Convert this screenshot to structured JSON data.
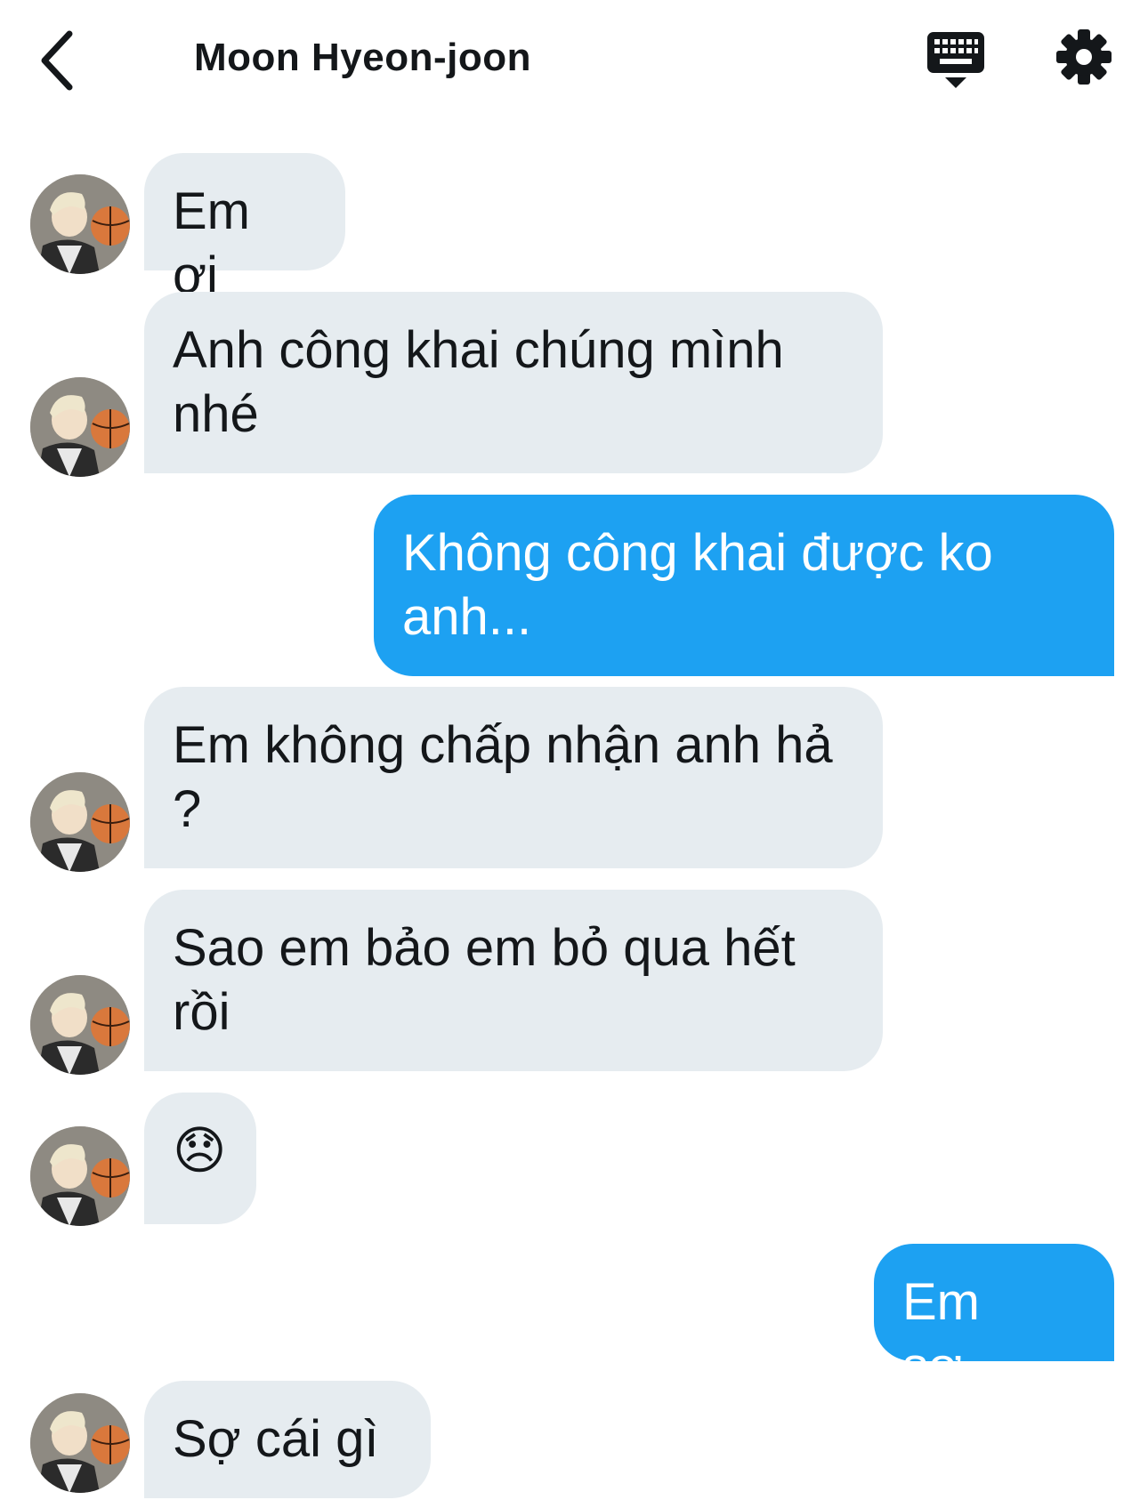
{
  "header": {
    "title": "Moon Hyeon-joon",
    "back_icon": "chevron-left-icon",
    "keyboard_icon": "keyboard-icon",
    "settings_icon": "gear-icon"
  },
  "colors": {
    "incoming_bubble": "#e6ecf0",
    "outgoing_bubble": "#1da1f2",
    "text_dark": "#14171a"
  },
  "messages": [
    {
      "side": "in",
      "text": "Em ơi"
    },
    {
      "side": "in",
      "text": "Anh công khai chúng mình nhé"
    },
    {
      "side": "out",
      "text": "Không công khai được ko anh..."
    },
    {
      "side": "in",
      "text": "Em không chấp nhận anh hả ?"
    },
    {
      "side": "in",
      "text": "Sao em bảo em bỏ qua hết rồi"
    },
    {
      "side": "in",
      "text": "😞"
    },
    {
      "side": "out",
      "text": "Em sợ.."
    },
    {
      "side": "in",
      "text": "Sợ cái gì"
    }
  ]
}
